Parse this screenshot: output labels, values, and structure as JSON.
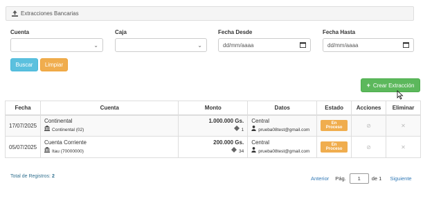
{
  "header": {
    "title": "Extracciones Bancarias",
    "icon": "upload-icon"
  },
  "filters": {
    "cuenta_label": "Cuenta",
    "caja_label": "Caja",
    "fecha_desde_label": "Fecha Desde",
    "fecha_hasta_label": "Fecha Hasta",
    "fecha_desde_placeholder": "dd/mm/aaaa",
    "fecha_hasta_placeholder": "dd/mm/aaaa",
    "buscar_label": "Buscar",
    "limpiar_label": "Limpiar"
  },
  "actions": {
    "crear_label": "Crear Extracción"
  },
  "table": {
    "headers": {
      "fecha": "Fecha",
      "cuenta": "Cuenta",
      "monto": "Monto",
      "datos": "Datos",
      "estado": "Estado",
      "acciones": "Acciones",
      "eliminar": "Eliminar"
    },
    "rows": [
      {
        "fecha": "17/07/2025",
        "cuenta": "Continental",
        "banco": "Continental (02)",
        "monto": "1.000.000 Gs.",
        "cantidad": "1",
        "caja": "Central",
        "usuario": "prueba08test@gmail.com",
        "estado": "En Proceso"
      },
      {
        "fecha": "05/07/2025",
        "cuenta": "Cuenta Corriente",
        "banco": "Itau (70000000)",
        "monto": "200.000 Gs.",
        "cantidad": "34",
        "caja": "Central",
        "usuario": "prueba08test@gmail.com",
        "estado": "En Proceso"
      }
    ]
  },
  "footer": {
    "total_label": "Total de Registros:",
    "total_value": "2"
  },
  "pagination": {
    "anterior": "Anterior",
    "pag_label": "Pág.",
    "page": "1",
    "de_label": "de 1",
    "siguiente": "Siguiente"
  },
  "colors": {
    "info": "#5bc0de",
    "warning": "#f0ad4e",
    "success": "#5cb85c",
    "link": "#337ab7"
  }
}
